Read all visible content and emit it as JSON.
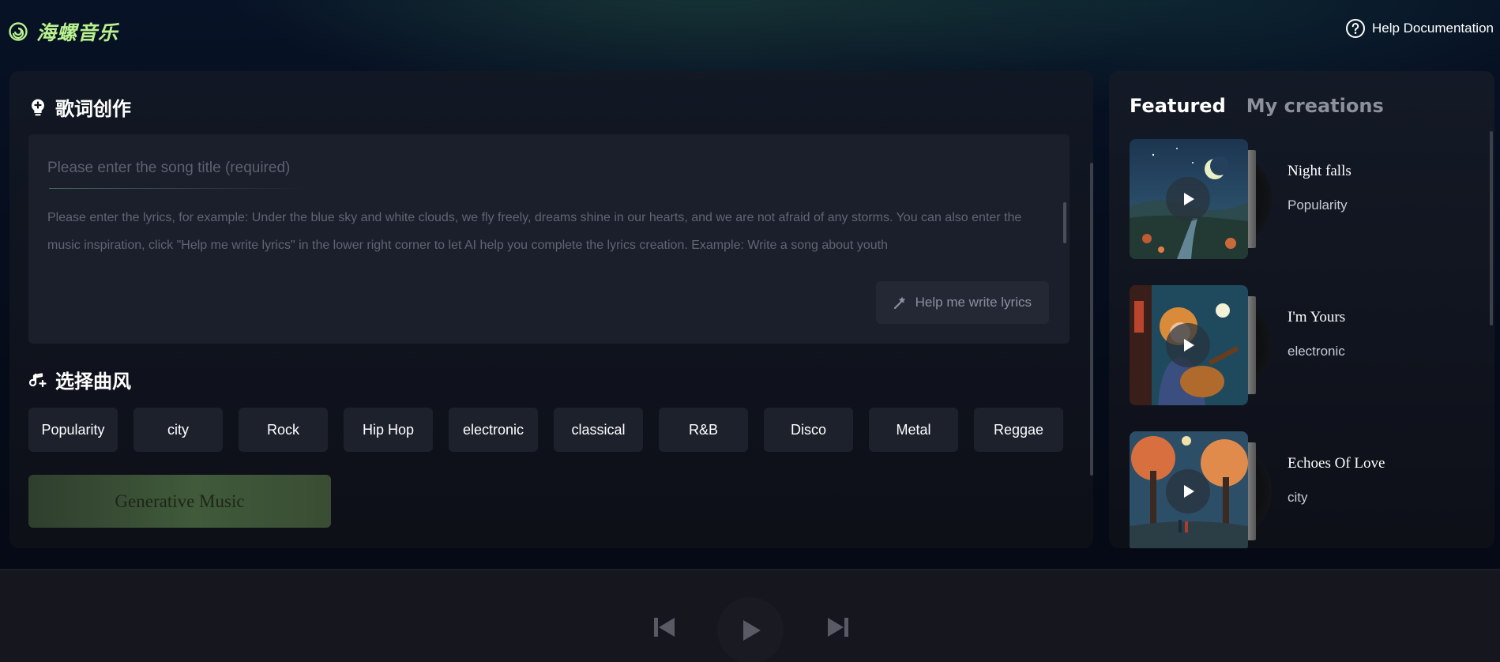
{
  "app": {
    "logo_text": "海螺音乐",
    "help_label": "Help Documentation",
    "accent_color": "#b9f28f"
  },
  "editor": {
    "section_title": "歌词创作",
    "title_placeholder": "Please enter the song title (required)",
    "lyrics_placeholder": "Please enter the lyrics, for example: Under the blue sky and white clouds, we fly freely, dreams shine in our hearts, and we are not afraid of any storms. You can also enter the music inspiration, click \"Help me write lyrics\" in the lower right corner to let AI help you complete the lyrics creation. Example: Write a song about youth",
    "help_write_label": "Help me write lyrics"
  },
  "styles": {
    "section_title": "选择曲风",
    "items": [
      "Popularity",
      "city",
      "Rock",
      "Hip Hop",
      "electronic",
      "classical",
      "R&B",
      "Disco",
      "Metal",
      "Reggae"
    ]
  },
  "generate": {
    "label": "Generative Music"
  },
  "sidebar": {
    "tabs": [
      {
        "label": "Featured",
        "active": true
      },
      {
        "label": "My creations",
        "active": false
      }
    ],
    "songs": [
      {
        "title": "Night falls",
        "tag": "Popularity",
        "cover": "night-landscape"
      },
      {
        "title": "I'm Yours",
        "tag": "electronic",
        "cover": "guitar-girl"
      },
      {
        "title": "Echoes Of Love",
        "tag": "city",
        "cover": "autumn-trees"
      }
    ]
  },
  "player": {
    "controls": [
      "previous-icon",
      "play-icon",
      "next-icon"
    ]
  }
}
